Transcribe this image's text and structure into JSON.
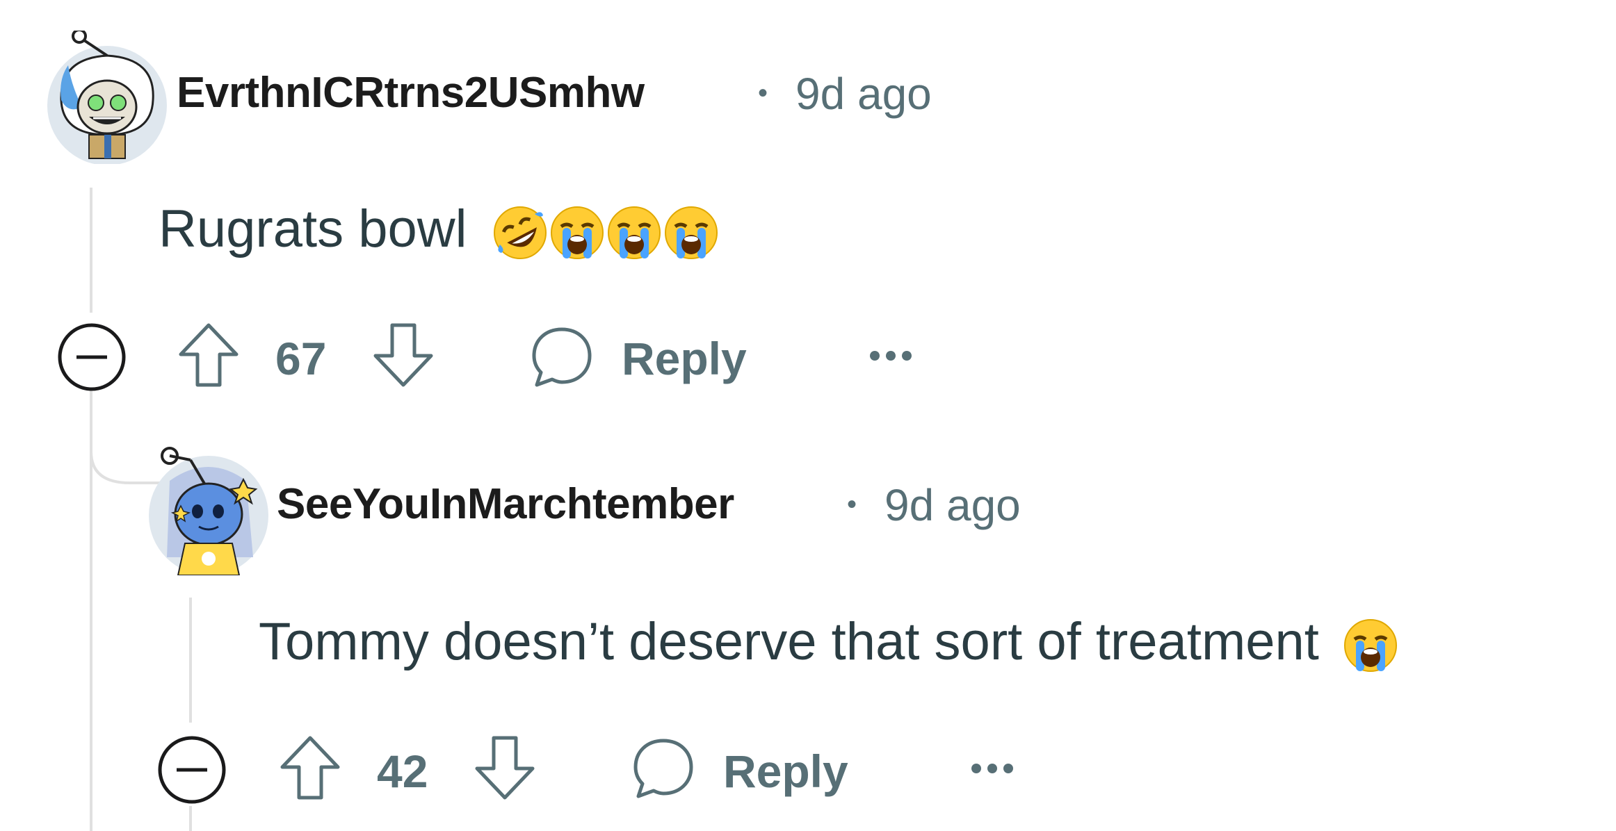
{
  "comments": [
    {
      "username": "EvrthnICRtrns2USmhw",
      "separator": "•",
      "time": "9d ago",
      "text": "Rugrats bowl",
      "emojis": [
        "rofl",
        "sob",
        "sob",
        "sob"
      ],
      "votes": "67",
      "reply_label": "Reply",
      "avatar": "snoo-avatar-white-hood"
    },
    {
      "username": "SeeYouInMarchtember",
      "separator": "•",
      "time": "9d ago",
      "text": "Tommy doesn’t deserve that sort of treatment",
      "emojis": [
        "sob"
      ],
      "votes": "42",
      "reply_label": "Reply",
      "avatar": "snoo-avatar-blue-hair"
    }
  ],
  "icons": {
    "collapse": "minus-circle-icon",
    "upvote": "arrow-up-icon",
    "downvote": "arrow-down-icon",
    "reply": "speech-bubble-icon",
    "more": "ellipsis-icon"
  },
  "colors": {
    "meta_gray": "#576f76",
    "body_text": "#2a3c42",
    "thread_line": "#e0e0e0",
    "emoji_yellow": "#ffcc33",
    "tear_blue": "#4aa3ff"
  }
}
